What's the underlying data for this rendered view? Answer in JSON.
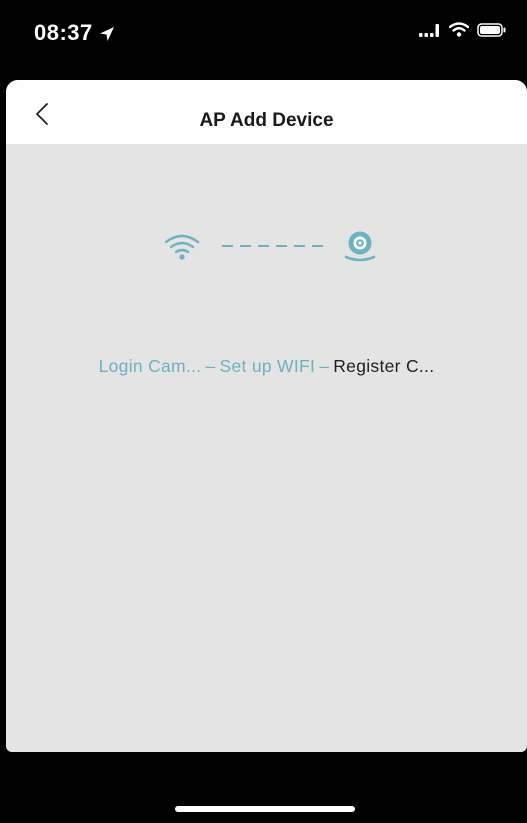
{
  "status_bar": {
    "time": "08:37"
  },
  "nav": {
    "title": "AP Add Device",
    "back_icon": "chevron-left-icon"
  },
  "graphic": {
    "wifi_icon": "wifi-icon",
    "camera_icon": "camera-icon",
    "dash_count": 6
  },
  "steps": {
    "items": [
      {
        "label": "Login Cam...",
        "state": "done"
      },
      {
        "label": "Set up WIFI",
        "state": "done"
      },
      {
        "label": "Register C...",
        "state": "current"
      }
    ],
    "separator": "–"
  },
  "colors": {
    "accent": "#6ab3c0",
    "card_bg": "#e4e4e4",
    "nav_bg": "#ffffff",
    "frame_bg": "#000000"
  }
}
